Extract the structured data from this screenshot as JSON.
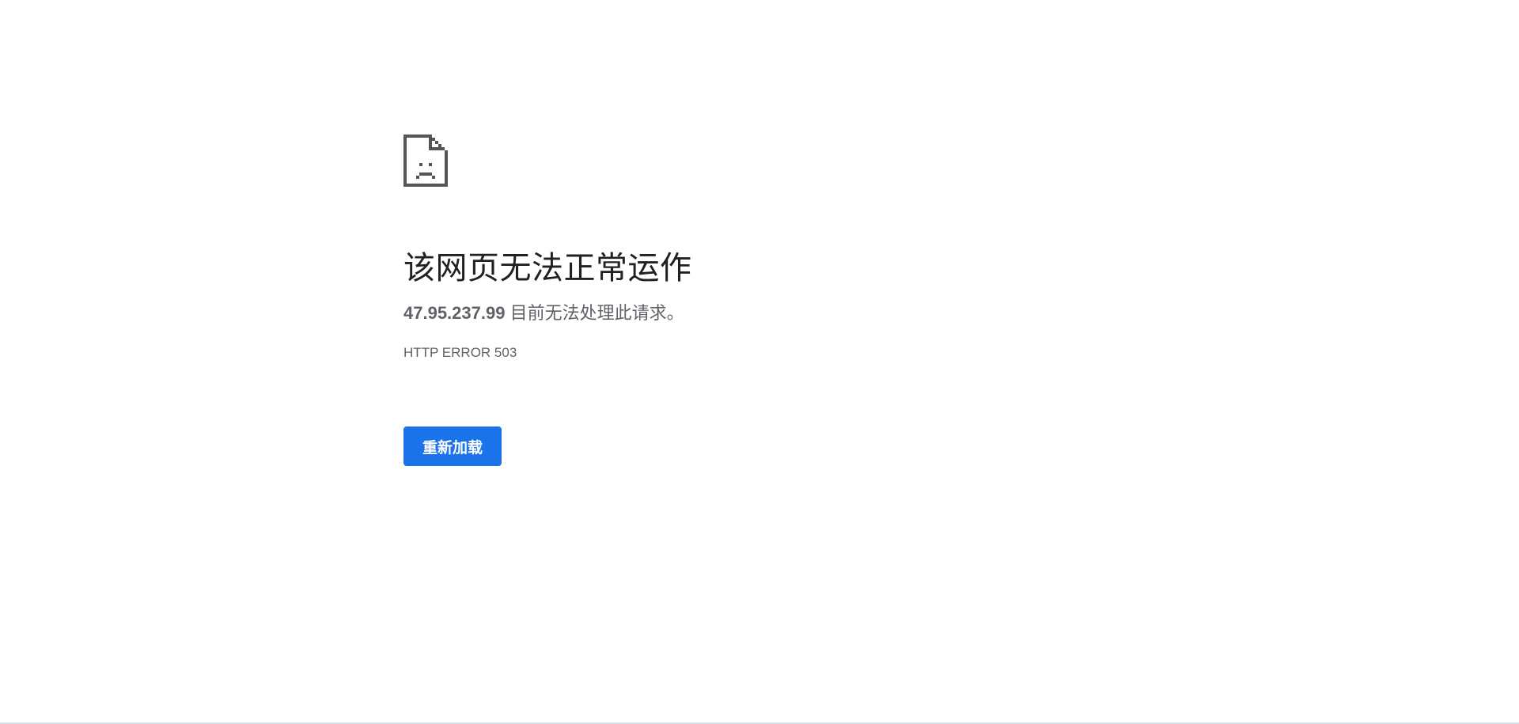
{
  "error": {
    "icon": "sad-page-icon",
    "title": "该网页无法正常运作",
    "host": "47.95.237.99",
    "message": "目前无法处理此请求。",
    "error_code": "HTTP ERROR 503",
    "reload_label": "重新加载"
  },
  "colors": {
    "accent": "#1a73e8",
    "title_text": "#202124",
    "secondary_text": "#5f6368",
    "icon": "#555555"
  }
}
